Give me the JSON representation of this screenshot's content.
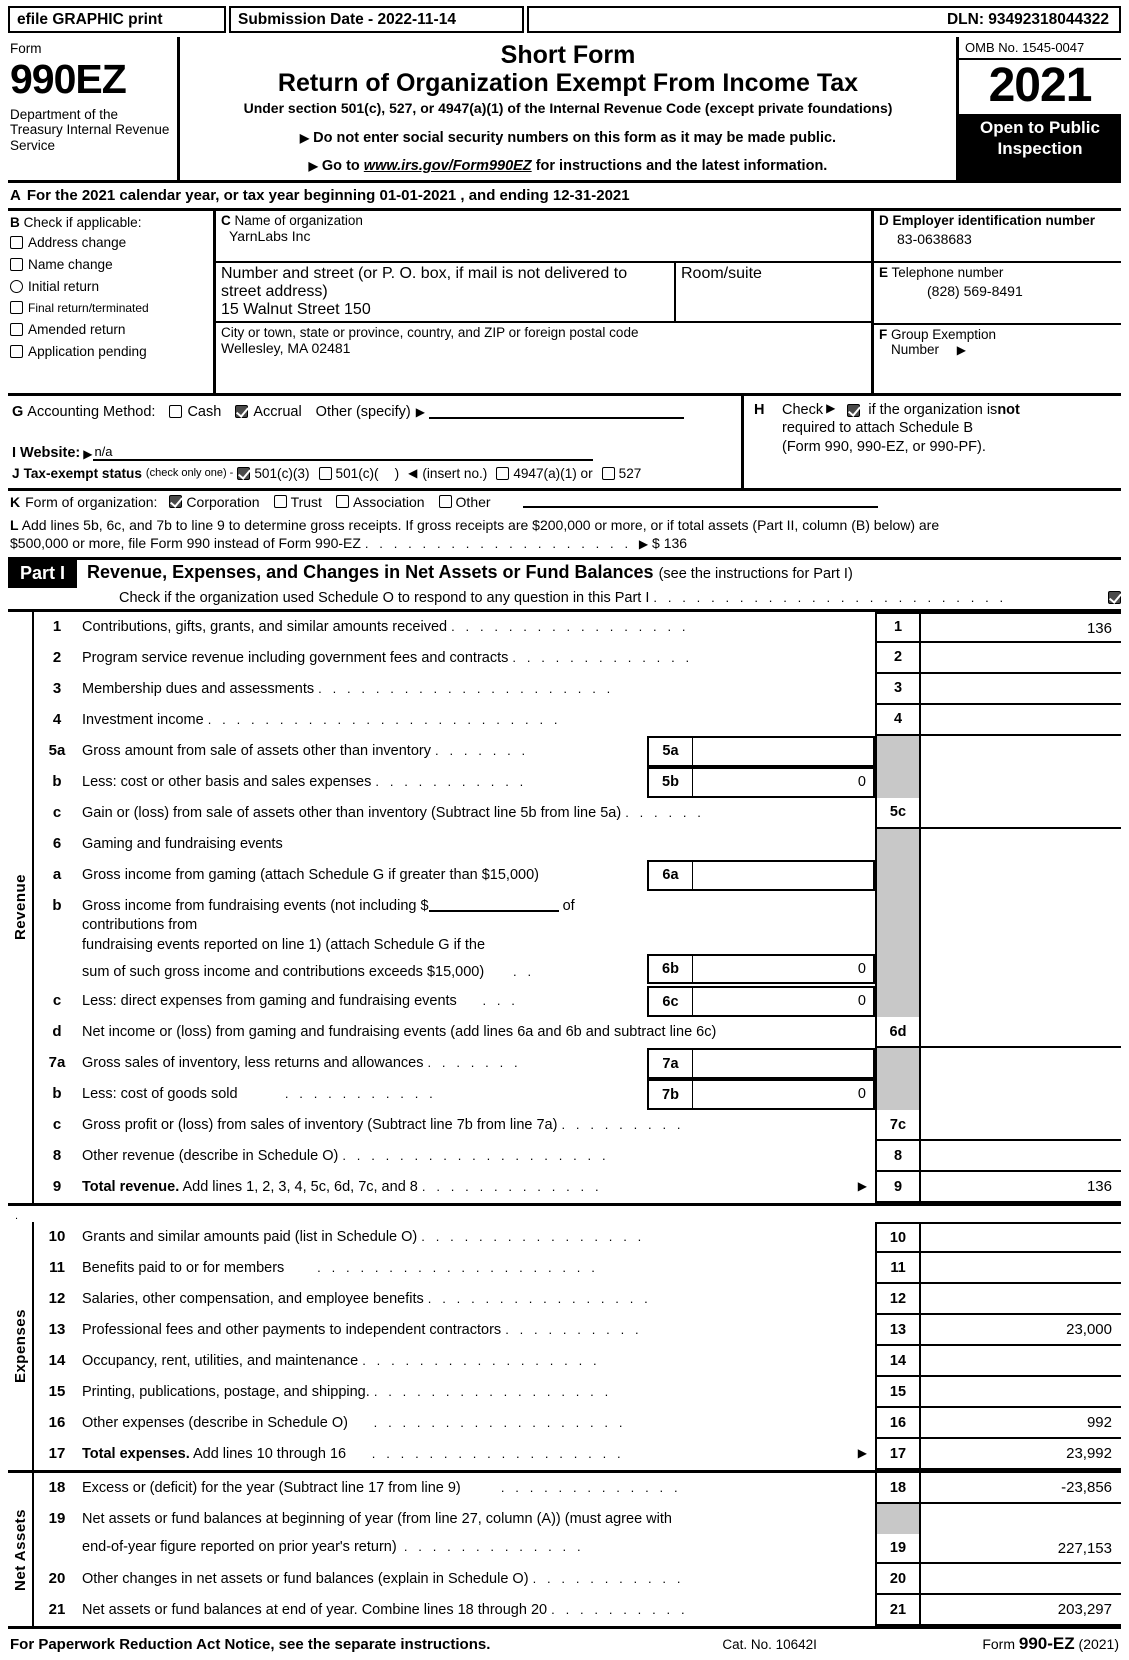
{
  "efile": {
    "graphic_print": "efile GRAPHIC print",
    "submission_date": "Submission Date - 2022-11-14",
    "dln": "DLN: 93492318044322"
  },
  "masthead": {
    "form_label": "Form",
    "form_number": "990EZ",
    "department": "Department of the Treasury Internal Revenue Service",
    "title_line1": "Short Form",
    "title_line2": "Return of Organization Exempt From Income Tax",
    "subtitle": "Under section 501(c), 527, or 4947(a)(1) of the Internal Revenue Code (except private foundations)",
    "note1": "Do not enter social security numbers on this form as it may be made public.",
    "note2_prefix": "Go to ",
    "note2_url": "www.irs.gov/Form990EZ",
    "note2_suffix": " for instructions and the latest information.",
    "omb": "OMB No. 1545-0047",
    "year": "2021",
    "open_to_public": "Open to Public Inspection"
  },
  "line_a": {
    "letter": "A",
    "text": "For the 2021 calendar year, or tax year beginning 01-01-2021 , and ending 12-31-2021"
  },
  "section_b": {
    "letter": "B",
    "header": "Check if applicable:",
    "items": [
      {
        "label": "Address change",
        "checked": false
      },
      {
        "label": "Name change",
        "checked": false
      },
      {
        "label": "Initial return",
        "checked": false
      },
      {
        "label": "Final return/terminated",
        "checked": false
      },
      {
        "label": "Amended return",
        "checked": false
      },
      {
        "label": "Application pending",
        "checked": false
      }
    ]
  },
  "section_c": {
    "letter": "C",
    "name_caption": "Name of organization",
    "name_value": "YarnLabs Inc",
    "street_caption": "Number and street (or P. O. box, if mail is not delivered to street address)",
    "street_value": "15 Walnut Street 150",
    "room_caption": "Room/suite",
    "room_value": "",
    "city_caption": "City or town, state or province, country, and ZIP or foreign postal code",
    "city_value": "Wellesley, MA   02481"
  },
  "section_d": {
    "letter": "D",
    "caption": "Employer identification number",
    "value": "83-0638683"
  },
  "section_e": {
    "letter": "E",
    "caption": "Telephone number",
    "value": "(828) 569-8491"
  },
  "section_f": {
    "letter": "F",
    "caption_line1": "Group Exemption",
    "caption_line2": "Number",
    "value": ""
  },
  "section_g": {
    "letter": "G",
    "label": "Accounting Method:",
    "cash_label": "Cash",
    "cash_checked": false,
    "accrual_label": "Accrual",
    "accrual_checked": true,
    "other_label": "Other (specify)",
    "other_value": ""
  },
  "section_h": {
    "letter": "H",
    "check_label": "Check",
    "checked": true,
    "text_part1": "if the organization is ",
    "text_bold": "not",
    "text_line2": "required to attach Schedule B",
    "text_line3": "(Form 990, 990-EZ, or 990-PF)."
  },
  "section_i": {
    "letter": "I Website:",
    "value": "n/a"
  },
  "section_j": {
    "letter": "J",
    "label": "Tax-exempt status",
    "note": "(check only one) -",
    "opt1_label": "501(c)(3)",
    "opt1_checked": true,
    "opt2_label_pre": "501(c)(",
    "opt2_label_post": ")",
    "opt2_checked": false,
    "insert_no": "(insert no.)",
    "opt3_label": "4947(a)(1) or",
    "opt3_checked": false,
    "opt4_label": "527",
    "opt4_checked": false
  },
  "section_k": {
    "letter": "K",
    "label": "Form of organization:",
    "options": [
      {
        "label": "Corporation",
        "checked": true
      },
      {
        "label": "Trust",
        "checked": false
      },
      {
        "label": "Association",
        "checked": false
      },
      {
        "label": "Other",
        "checked": false
      }
    ]
  },
  "section_l": {
    "letter": "L",
    "line1": "Add lines 5b, 6c, and 7b to line 9 to determine gross receipts. If gross receipts are $200,000 or more, or if total assets (Part II, column (B) below) are",
    "line2": "$500,000 or more, file Form 990 instead of Form 990-EZ",
    "amount": "$ 136"
  },
  "part1": {
    "label": "Part I",
    "title": "Revenue, Expenses, and Changes in Net Assets or Fund Balances",
    "title_note": "(see the instructions for Part I)",
    "subtext": "Check if the organization used Schedule O to respond to any question in this Part I",
    "sub_checked": true
  },
  "side_labels": {
    "revenue": "Revenue",
    "expenses": "Expenses",
    "net_assets": "Net Assets"
  },
  "revenue_rows": [
    {
      "num": "1",
      "desc": "Contributions, gifts, grants, and similar amounts received",
      "dots": true,
      "key": "1",
      "value": "136"
    },
    {
      "num": "2",
      "desc": "Program service revenue including government fees and contracts",
      "dots": true,
      "key": "2",
      "value": ""
    },
    {
      "num": "3",
      "desc": "Membership dues and assessments",
      "dots": true,
      "key": "3",
      "value": ""
    },
    {
      "num": "4",
      "desc": "Investment income",
      "dots": true,
      "key": "4",
      "value": ""
    },
    {
      "num": "5a",
      "desc": "Gross amount from sale of assets other than inventory",
      "dots": true,
      "sub_key": "5a",
      "sub_value": ""
    },
    {
      "num": "b",
      "desc": "Less: cost or other basis and sales expenses",
      "dots": true,
      "sub_key": "5b",
      "sub_value": "0"
    },
    {
      "num": "c",
      "desc": "Gain or (loss) from sale of assets other than inventory (Subtract line 5b from line 5a)",
      "dots": true,
      "key": "5c",
      "value": ""
    },
    {
      "num": "6",
      "desc": "Gaming and fundraising events",
      "dots": false
    },
    {
      "num": "a",
      "desc": "Gross income from gaming (attach Schedule G if greater than $15,000)",
      "dots": false,
      "sub_key": "6a",
      "sub_value": ""
    },
    {
      "num": "b",
      "desc": "Gross income from fundraising events (not including $ ____ of contributions from fundraising events reported on line 1) (attach Schedule G if the sum of such gross income and contributions exceeds $15,000)",
      "dots": true,
      "sub_key": "6b",
      "sub_value": "0"
    },
    {
      "num": "c",
      "desc": "Less: direct expenses from gaming and fundraising events",
      "dots": true,
      "sub_key": "6c",
      "sub_value": "0"
    },
    {
      "num": "d",
      "desc": "Net income or (loss) from gaming and fundraising events (add lines 6a and 6b and subtract line 6c)",
      "dots": false,
      "key": "6d",
      "value": ""
    },
    {
      "num": "7a",
      "desc": "Gross sales of inventory, less returns and allowances",
      "dots": true,
      "sub_key": "7a",
      "sub_value": ""
    },
    {
      "num": "b",
      "desc": "Less: cost of goods sold",
      "dots": true,
      "sub_key": "7b",
      "sub_value": "0"
    },
    {
      "num": "c",
      "desc": "Gross profit or (loss) from sales of inventory (Subtract line 7b from line 7a)",
      "dots": true,
      "key": "7c",
      "value": ""
    },
    {
      "num": "8",
      "desc": "Other revenue (describe in Schedule O)",
      "dots": true,
      "key": "8",
      "value": ""
    },
    {
      "num": "9",
      "desc": "Total revenue. Add lines 1, 2, 3, 4, 5c, 6d, 7c, and 8",
      "bold_prefix": "Total revenue.",
      "dots": true,
      "arrow": true,
      "key": "9",
      "value": "136"
    }
  ],
  "expense_rows": [
    {
      "num": "10",
      "desc": "Grants and similar amounts paid (list in Schedule O)",
      "dots": true,
      "key": "10",
      "value": ""
    },
    {
      "num": "11",
      "desc": "Benefits paid to or for members",
      "dots": true,
      "key": "11",
      "value": ""
    },
    {
      "num": "12",
      "desc": "Salaries, other compensation, and employee benefits",
      "dots": true,
      "key": "12",
      "value": ""
    },
    {
      "num": "13",
      "desc": "Professional fees and other payments to independent contractors",
      "dots": true,
      "key": "13",
      "value": "23,000"
    },
    {
      "num": "14",
      "desc": "Occupancy, rent, utilities, and maintenance",
      "dots": true,
      "key": "14",
      "value": ""
    },
    {
      "num": "15",
      "desc": "Printing, publications, postage, and shipping.",
      "dots": true,
      "key": "15",
      "value": ""
    },
    {
      "num": "16",
      "desc": "Other expenses (describe in Schedule O)",
      "dots": true,
      "key": "16",
      "value": "992"
    },
    {
      "num": "17",
      "desc": "Total expenses. Add lines 10 through 16",
      "bold_prefix": "Total expenses.",
      "dots": true,
      "arrow": true,
      "key": "17",
      "value": "23,992"
    }
  ],
  "netasset_rows": [
    {
      "num": "18",
      "desc": "Excess or (deficit) for the year (Subtract line 17 from line 9)",
      "dots": true,
      "key": "18",
      "value": "-23,856"
    },
    {
      "num": "19",
      "desc": "Net assets or fund balances at beginning of year (from line 27, column (A)) (must agree with end-of-year figure reported on prior year's return)",
      "dots": true,
      "key": "19",
      "value": "227,153"
    },
    {
      "num": "20",
      "desc": "Other changes in net assets or fund balances (explain in Schedule O)",
      "dots": true,
      "key": "20",
      "value": ""
    },
    {
      "num": "21",
      "desc": "Net assets or fund balances at end of year. Combine lines 18 through 20",
      "dots": true,
      "key": "21",
      "value": "203,297"
    }
  ],
  "footer": {
    "left": "For Paperwork Reduction Act Notice, see the separate instructions.",
    "center": "Cat. No. 10642I",
    "right_pre": "Form ",
    "right_bold": "990-EZ",
    "right_post": " (2021)"
  }
}
